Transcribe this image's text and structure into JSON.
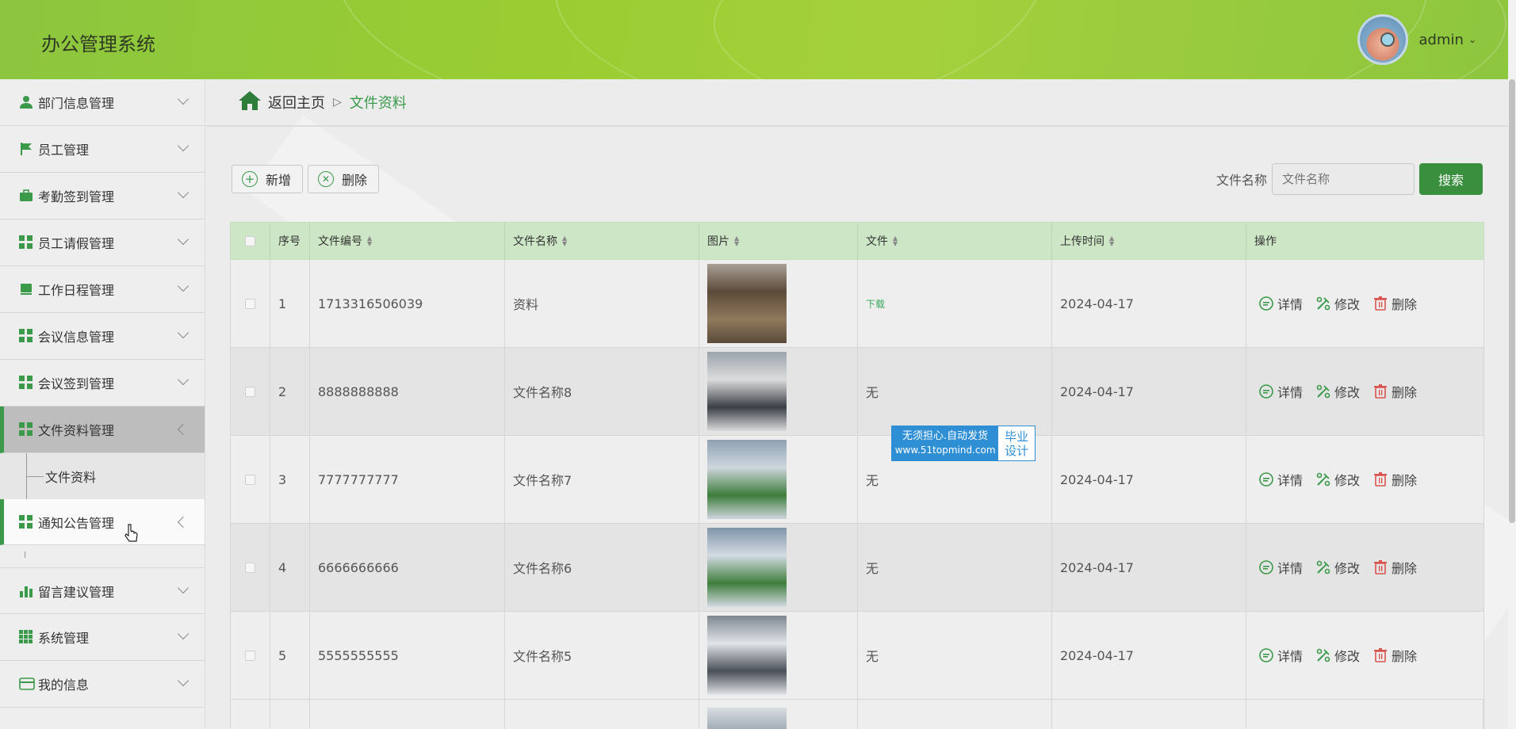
{
  "header": {
    "app_title": "办公管理系统",
    "username": "admin",
    "caret": "⌄"
  },
  "sidebar": {
    "items": [
      {
        "label": "部门信息管理",
        "icon": "user-icon"
      },
      {
        "label": "员工管理",
        "icon": "flag-icon"
      },
      {
        "label": "考勤签到管理",
        "icon": "briefcase-icon"
      },
      {
        "label": "员工请假管理",
        "icon": "grid-icon"
      },
      {
        "label": "工作日程管理",
        "icon": "book-icon"
      },
      {
        "label": "会议信息管理",
        "icon": "grid-icon"
      },
      {
        "label": "会议签到管理",
        "icon": "grid-icon"
      },
      {
        "label": "文件资料管理",
        "icon": "grid-icon"
      },
      {
        "label": "通知公告管理",
        "icon": "grid-icon"
      },
      {
        "label": "留言建议管理",
        "icon": "bar-chart-icon"
      },
      {
        "label": "系统管理",
        "icon": "grid9-icon"
      },
      {
        "label": "我的信息",
        "icon": "card-icon"
      }
    ],
    "submenu": {
      "label": "文件资料"
    }
  },
  "breadcrumb": {
    "home": "返回主页",
    "separator": "▷",
    "current": "文件资料"
  },
  "toolbar": {
    "add_label": "新增",
    "delete_label": "删除"
  },
  "search": {
    "label": "文件名称",
    "placeholder": "文件名称",
    "button": "搜索"
  },
  "table": {
    "columns": [
      "序号",
      "文件编号",
      "文件名称",
      "图片",
      "文件",
      "上传时间",
      "操作"
    ],
    "rows": [
      {
        "index": "1",
        "code": "1713316506039",
        "name": "资料",
        "file": "下载",
        "time": "2024-04-17"
      },
      {
        "index": "2",
        "code": "8888888888",
        "name": "文件名称8",
        "file": "无",
        "time": "2024-04-17"
      },
      {
        "index": "3",
        "code": "7777777777",
        "name": "文件名称7",
        "file": "无",
        "time": "2024-04-17"
      },
      {
        "index": "4",
        "code": "6666666666",
        "name": "文件名称6",
        "file": "无",
        "time": "2024-04-17"
      },
      {
        "index": "5",
        "code": "5555555555",
        "name": "文件名称5",
        "file": "无",
        "time": "2024-04-17"
      }
    ],
    "actions": {
      "detail": "详情",
      "edit": "修改",
      "delete": "删除"
    }
  },
  "watermark": {
    "line1": "无须担心.自动发货",
    "line2": "www.51topmind.com",
    "right1": "毕业",
    "right2": "设计"
  },
  "colors": {
    "accent": "#3a9a4a",
    "header_green": "#9acd32",
    "table_header": "#cde7c6"
  }
}
